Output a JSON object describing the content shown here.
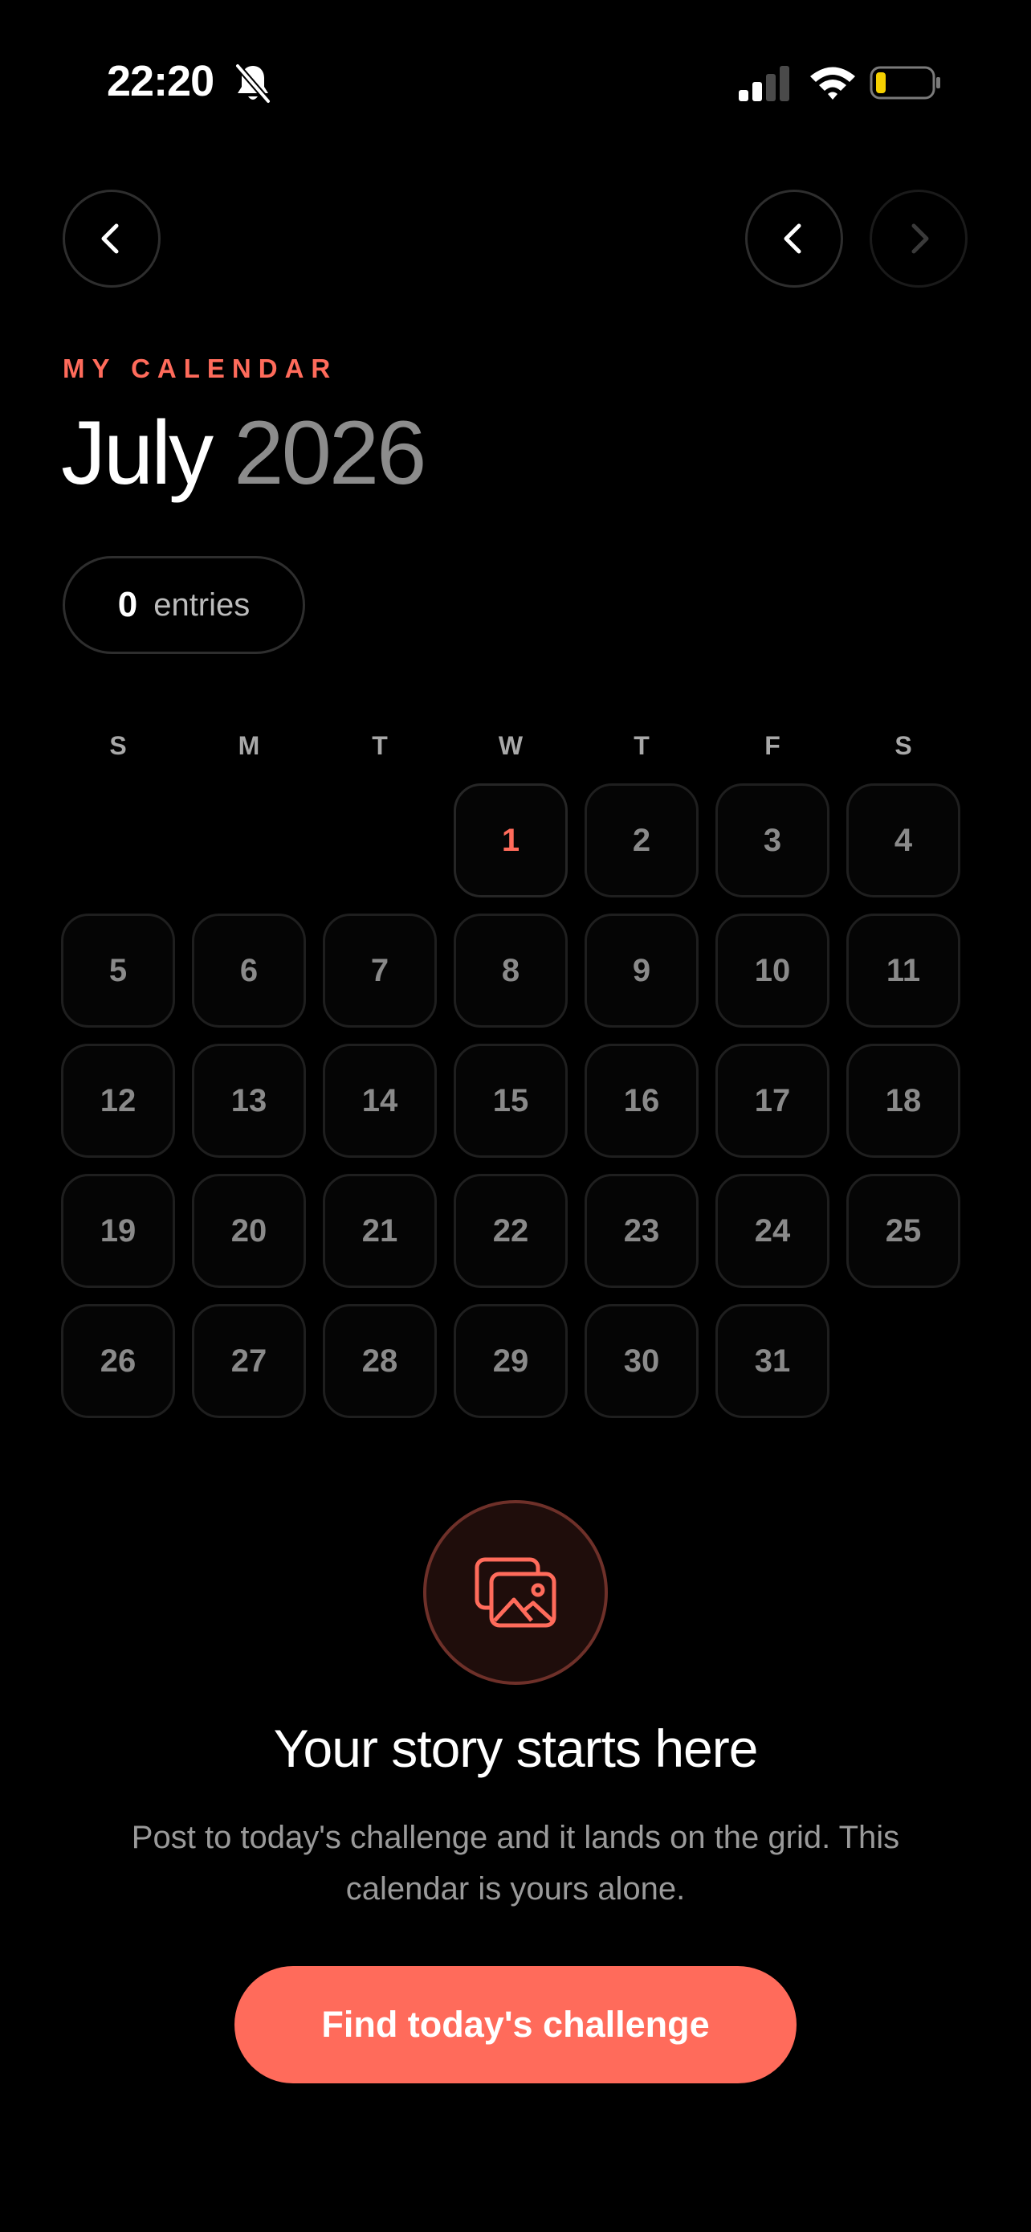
{
  "status_bar": {
    "time": "22:20",
    "icons": [
      "bell-slash-icon",
      "cellular-signal-icon",
      "wifi-icon",
      "battery-low-icon"
    ]
  },
  "nav": {
    "back_icon": "chevron-left-icon",
    "prev_month_icon": "chevron-left-icon",
    "next_month_icon": "chevron-right-icon"
  },
  "header": {
    "overline": "MY CALENDAR",
    "month": "July",
    "year": "2026"
  },
  "entries": {
    "count": "0",
    "label": "entries"
  },
  "calendar": {
    "weekdays": [
      "S",
      "M",
      "T",
      "W",
      "T",
      "F",
      "S"
    ],
    "first_weekday_index": 3,
    "days": [
      "1",
      "2",
      "3",
      "4",
      "5",
      "6",
      "7",
      "8",
      "9",
      "10",
      "11",
      "12",
      "13",
      "14",
      "15",
      "16",
      "17",
      "18",
      "19",
      "20",
      "21",
      "22",
      "23",
      "24",
      "25",
      "26",
      "27",
      "28",
      "29",
      "30",
      "31"
    ],
    "today": "1"
  },
  "empty_state": {
    "icon": "image-stack-icon",
    "title": "Your story starts here",
    "body": "Post to today's challenge and it lands on the grid. This calendar is yours alone.",
    "cta_label": "Find today's challenge"
  },
  "colors": {
    "accent": "#ff6b5b",
    "background": "#000000",
    "battery_low": "#f5d000"
  }
}
